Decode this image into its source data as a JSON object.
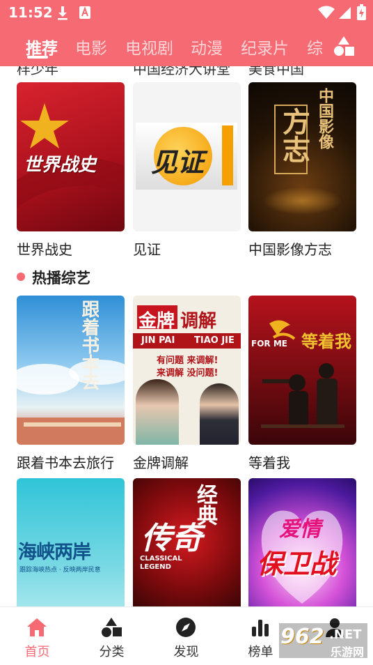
{
  "status_bar": {
    "time": "11:52"
  },
  "tabs": [
    {
      "label": "推荐",
      "active": true
    },
    {
      "label": "电影",
      "active": false
    },
    {
      "label": "电视剧",
      "active": false
    },
    {
      "label": "动漫",
      "active": false
    },
    {
      "label": "纪录片",
      "active": false
    },
    {
      "label": "综",
      "active": false
    }
  ],
  "previous_row_titles": [
    "样少年",
    "中国经济大讲堂",
    "美食中国"
  ],
  "documentary_row": [
    {
      "title": "世界战史",
      "poster_text": "世界战史"
    },
    {
      "title": "见证",
      "poster_text": "见证"
    },
    {
      "title": "中国影像方志",
      "poster_text_1": "方志",
      "poster_text_2": "中国影像"
    }
  ],
  "variety_section": {
    "title": "热播综艺",
    "row1": [
      {
        "title": "跟着书本去旅行",
        "poster_text": "跟着书本去旅行"
      },
      {
        "title": "金牌调解",
        "poster_text_1": "金牌",
        "poster_text_2": "调解",
        "poster_text_3": "JIN PAI",
        "poster_text_4": "TIAO JIE",
        "poster_text_5": "有问题 来调解!",
        "poster_text_6": "来调解 没问题!"
      },
      {
        "title": "等着我",
        "poster_text_1": "等着我",
        "poster_text_2": "FOR ME"
      }
    ],
    "row2": [
      {
        "poster_text_1": "海峡两岸",
        "poster_text_2": "跟踪海峡热点 · 反映两岸民意"
      },
      {
        "poster_text_1": "传奇",
        "poster_text_2": "经典",
        "poster_text_3": "CLASSICAL",
        "poster_text_4": "LEGEND"
      },
      {
        "poster_text_1": "爱情",
        "poster_text_2": "保卫战"
      }
    ]
  },
  "bottom_nav": [
    {
      "label": "首页",
      "active": true
    },
    {
      "label": "分类",
      "active": false
    },
    {
      "label": "发现",
      "active": false
    },
    {
      "label": "榜单",
      "active": false
    },
    {
      "label": "",
      "active": false
    }
  ],
  "watermark": {
    "text_1": "962",
    "text_2": ".NET",
    "text_3": "乐游网"
  },
  "colors": {
    "accent": "#f56a73",
    "text": "#222222"
  }
}
